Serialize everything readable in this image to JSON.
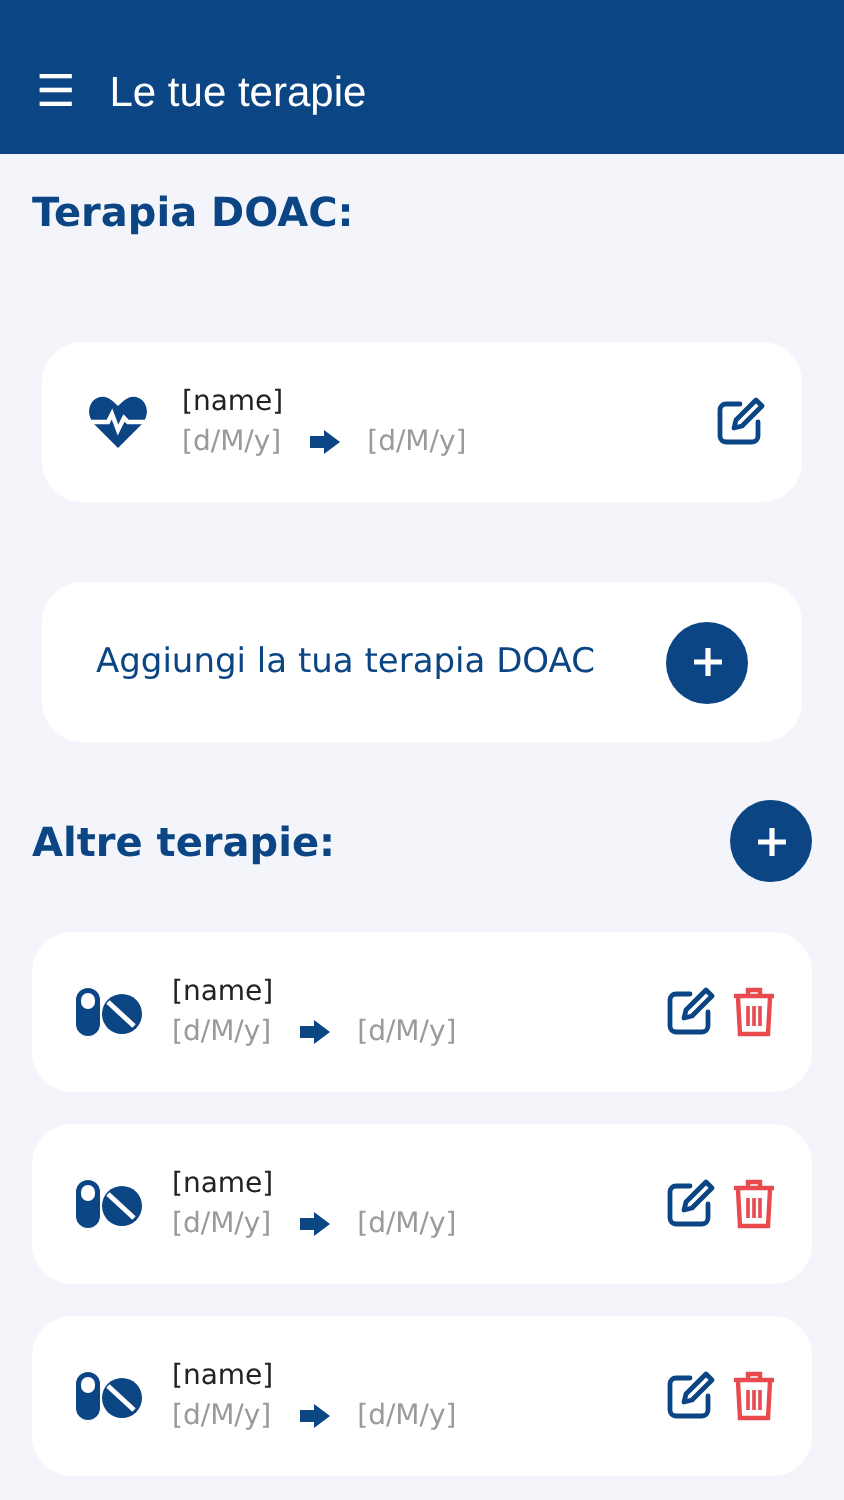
{
  "header": {
    "menu_icon": "☰",
    "title": "Le tue terapie"
  },
  "doac": {
    "heading": "Terapia DOAC:",
    "therapies": [
      {
        "kind": "heart",
        "name": "[name]",
        "start": "[d/M/y]",
        "end": "[d/M/y]",
        "deletable": false
      }
    ],
    "add_label": "Aggiungi la tua terapia DOAC"
  },
  "other": {
    "heading": "Altre terapie:",
    "therapies": [
      {
        "kind": "pills",
        "name": "[name]",
        "start": "[d/M/y]",
        "end": "[d/M/y]",
        "deletable": true
      },
      {
        "kind": "pills",
        "name": "[name]",
        "start": "[d/M/y]",
        "end": "[d/M/y]",
        "deletable": true
      },
      {
        "kind": "pills",
        "name": "[name]",
        "start": "[d/M/y]",
        "end": "[d/M/y]",
        "deletable": true
      }
    ]
  }
}
